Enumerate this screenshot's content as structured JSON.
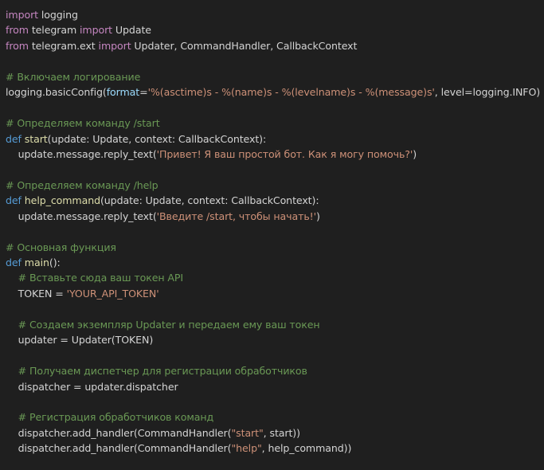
{
  "colors": {
    "background": "#1f1f1f",
    "default_text": "#d4d4d4",
    "keyword": "#569cd6",
    "control_keyword": "#c586c0",
    "function": "#dcdcaa",
    "string": "#ce9178",
    "comment": "#6a9955",
    "parameter": "#9cdcfe",
    "class": "#4ec9b0"
  },
  "code": {
    "lines": [
      [
        {
          "t": "import",
          "c": "ctl"
        },
        {
          "t": " logging",
          "c": "txt"
        }
      ],
      [
        {
          "t": "from",
          "c": "ctl"
        },
        {
          "t": " telegram ",
          "c": "txt"
        },
        {
          "t": "import",
          "c": "ctl"
        },
        {
          "t": " Update",
          "c": "txt"
        }
      ],
      [
        {
          "t": "from",
          "c": "ctl"
        },
        {
          "t": " telegram.ext ",
          "c": "txt"
        },
        {
          "t": "import",
          "c": "ctl"
        },
        {
          "t": " Updater, CommandHandler, CallbackContext",
          "c": "txt"
        }
      ],
      [],
      [
        {
          "t": "# Включаем логирование",
          "c": "cm"
        }
      ],
      [
        {
          "t": "logging.basicConfig(",
          "c": "txt"
        },
        {
          "t": "format",
          "c": "prm"
        },
        {
          "t": "=",
          "c": "txt"
        },
        {
          "t": "'%(asctime)s - %(name)s - %(levelname)s - %(message)s'",
          "c": "str"
        },
        {
          "t": ", level=logging.INFO)",
          "c": "txt"
        }
      ],
      [],
      [
        {
          "t": "# Определяем команду /start",
          "c": "cm"
        }
      ],
      [
        {
          "t": "def",
          "c": "kw"
        },
        {
          "t": " ",
          "c": "txt"
        },
        {
          "t": "start",
          "c": "fn"
        },
        {
          "t": "(update: Update, context: CallbackContext):",
          "c": "txt"
        }
      ],
      [
        {
          "t": "    update.message.reply_text(",
          "c": "txt"
        },
        {
          "t": "'Привет! Я ваш простой бот. Как я могу помочь?'",
          "c": "str"
        },
        {
          "t": ")",
          "c": "txt"
        }
      ],
      [],
      [
        {
          "t": "# Определяем команду /help",
          "c": "cm"
        }
      ],
      [
        {
          "t": "def",
          "c": "kw"
        },
        {
          "t": " ",
          "c": "txt"
        },
        {
          "t": "help_command",
          "c": "fn"
        },
        {
          "t": "(update: Update, context: CallbackContext):",
          "c": "txt"
        }
      ],
      [
        {
          "t": "    update.message.reply_text(",
          "c": "txt"
        },
        {
          "t": "'Введите /start, чтобы начать!'",
          "c": "str"
        },
        {
          "t": ")",
          "c": "txt"
        }
      ],
      [],
      [
        {
          "t": "# Основная функция",
          "c": "cm"
        }
      ],
      [
        {
          "t": "def",
          "c": "kw"
        },
        {
          "t": " ",
          "c": "txt"
        },
        {
          "t": "main",
          "c": "fn"
        },
        {
          "t": "():",
          "c": "txt"
        }
      ],
      [
        {
          "t": "    ",
          "c": "txt"
        },
        {
          "t": "# Вставьте сюда ваш токен API",
          "c": "cm"
        }
      ],
      [
        {
          "t": "    TOKEN = ",
          "c": "txt"
        },
        {
          "t": "'YOUR_API_TOKEN'",
          "c": "str"
        }
      ],
      [],
      [
        {
          "t": "    ",
          "c": "txt"
        },
        {
          "t": "# Создаем экземпляр Updater и передаем ему ваш токен",
          "c": "cm"
        }
      ],
      [
        {
          "t": "    updater = Updater(TOKEN)",
          "c": "txt"
        }
      ],
      [],
      [
        {
          "t": "    ",
          "c": "txt"
        },
        {
          "t": "# Получаем диспетчер для регистрации обработчиков",
          "c": "cm"
        }
      ],
      [
        {
          "t": "    dispatcher = updater.dispatcher",
          "c": "txt"
        }
      ],
      [],
      [
        {
          "t": "    ",
          "c": "txt"
        },
        {
          "t": "# Регистрация обработчиков команд",
          "c": "cm"
        }
      ],
      [
        {
          "t": "    dispatcher.add_handler(CommandHandler(",
          "c": "txt"
        },
        {
          "t": "\"start\"",
          "c": "str"
        },
        {
          "t": ", start))",
          "c": "txt"
        }
      ],
      [
        {
          "t": "    dispatcher.add_handler(CommandHandler(",
          "c": "txt"
        },
        {
          "t": "\"help\"",
          "c": "str"
        },
        {
          "t": ", help_command))",
          "c": "txt"
        }
      ]
    ]
  }
}
